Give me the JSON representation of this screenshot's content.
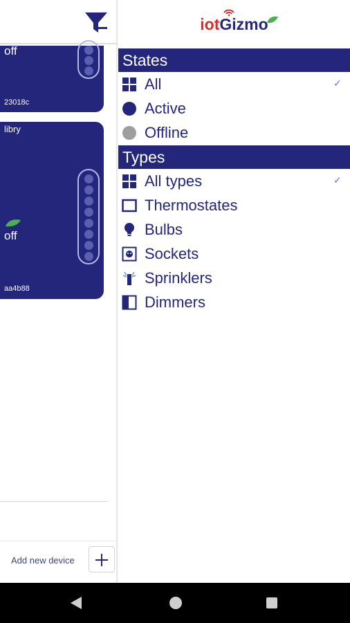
{
  "background_list": {
    "devices": [
      {
        "name": "",
        "state": "off",
        "id": "23018c"
      },
      {
        "name": "libry",
        "state": "off",
        "id": "aa4b88"
      }
    ],
    "add_device_label": "Add new device"
  },
  "drawer": {
    "logo": {
      "part1": "iot",
      "part2": "Gizmo"
    },
    "states_header": "States",
    "states": [
      {
        "label": "All",
        "icon": "grid-icon",
        "selected": true
      },
      {
        "label": "Active",
        "icon": "active-dot-icon",
        "selected": false
      },
      {
        "label": "Offline",
        "icon": "offline-dot-icon",
        "selected": false
      }
    ],
    "types_header": "Types",
    "types": [
      {
        "label": "All types",
        "icon": "grid-icon",
        "selected": true
      },
      {
        "label": "Thermostates",
        "icon": "thermostat-icon",
        "selected": false
      },
      {
        "label": "Bulbs",
        "icon": "bulb-icon",
        "selected": false
      },
      {
        "label": "Sockets",
        "icon": "socket-icon",
        "selected": false
      },
      {
        "label": "Sprinklers",
        "icon": "sprinkler-icon",
        "selected": false
      },
      {
        "label": "Dimmers",
        "icon": "dimmer-icon",
        "selected": false
      }
    ],
    "check_mark": "✓"
  },
  "colors": {
    "primary": "#23267a",
    "brand_red": "#d32f2f",
    "leaf_green": "#4caf50",
    "offline_gray": "#9e9e9e",
    "check_blue": "#5a7bd8"
  }
}
